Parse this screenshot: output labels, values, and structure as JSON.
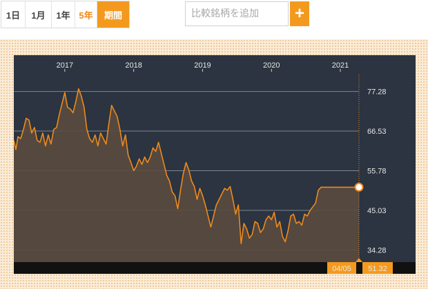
{
  "toolbar": {
    "ranges": [
      "1日",
      "1月",
      "1年",
      "5年",
      "期間"
    ],
    "active_range": "5年",
    "search_placeholder": "比較銘柄を追加",
    "add_button_label": "+"
  },
  "colors": {
    "accent": "#f39a1e",
    "panel": "#2b3440",
    "line": "#ef8a1c",
    "fill": "#5a4a3f",
    "grid": "#9aa3ad"
  },
  "chart_data": {
    "type": "area",
    "x_tick_labels": [
      "2017",
      "2018",
      "2019",
      "2020",
      "2021"
    ],
    "y_tick_labels": [
      "77.28",
      "66.53",
      "55.78",
      "45.03",
      "34.28"
    ],
    "ylim": [
      31.0,
      83.0
    ],
    "xlim": [
      2016.26,
      2021.27
    ],
    "grid": true,
    "current_date_label": "04/05",
    "current_value_label": "51.32",
    "series": [
      {
        "x": [
          2016.26,
          2016.29,
          2016.32,
          2016.36,
          2016.4,
          2016.44,
          2016.48,
          2016.52,
          2016.56,
          2016.6,
          2016.64,
          2016.68,
          2016.72,
          2016.76,
          2016.8,
          2016.84,
          2016.88,
          2016.92,
          2016.96,
          2017.0,
          2017.04,
          2017.08,
          2017.12,
          2017.16,
          2017.2,
          2017.24,
          2017.28,
          2017.32,
          2017.36,
          2017.4,
          2017.44,
          2017.48,
          2017.52,
          2017.56,
          2017.6,
          2017.64,
          2017.68,
          2017.72,
          2017.76,
          2017.8,
          2017.84,
          2017.88,
          2017.92,
          2017.96,
          2018.0,
          2018.04,
          2018.08,
          2018.12,
          2018.16,
          2018.2,
          2018.24,
          2018.28,
          2018.32,
          2018.36,
          2018.4,
          2018.44,
          2018.48,
          2018.52,
          2018.56,
          2018.6,
          2018.64,
          2018.68,
          2018.72,
          2018.76,
          2018.8,
          2018.84,
          2018.88,
          2018.92,
          2018.96,
          2019.0,
          2019.04,
          2019.08,
          2019.12,
          2019.16,
          2019.2,
          2019.24,
          2019.28,
          2019.32,
          2019.36,
          2019.4,
          2019.44,
          2019.48,
          2019.52,
          2019.56,
          2019.6,
          2019.64,
          2019.68,
          2019.72,
          2019.76,
          2019.8,
          2019.84,
          2019.88,
          2019.92,
          2019.96,
          2020.0,
          2020.04,
          2020.08,
          2020.12,
          2020.16,
          2020.2,
          2020.24,
          2020.28,
          2020.32,
          2020.36,
          2020.4,
          2020.44,
          2020.48,
          2020.52,
          2020.56,
          2020.6,
          2020.64,
          2020.68,
          2020.72,
          2020.76,
          2020.8,
          2020.84,
          2020.88,
          2020.92,
          2020.96,
          2021.0,
          2021.04,
          2021.08,
          2021.12,
          2021.16,
          2021.2,
          2021.24,
          2021.27
        ],
        "y": [
          64.0,
          61.5,
          65.0,
          64.5,
          67.0,
          70.0,
          69.5,
          66.0,
          67.5,
          64.0,
          63.5,
          66.0,
          62.5,
          65.5,
          63.0,
          67.0,
          67.5,
          71.0,
          74.0,
          77.0,
          73.0,
          72.5,
          71.5,
          74.5,
          78.0,
          76.0,
          73.0,
          67.0,
          64.5,
          63.5,
          65.5,
          62.5,
          66.0,
          64.5,
          63.0,
          68.5,
          73.5,
          72.0,
          70.5,
          67.0,
          62.5,
          65.5,
          60.0,
          58.0,
          55.8,
          57.0,
          59.0,
          57.5,
          59.5,
          58.0,
          59.5,
          62.0,
          61.0,
          63.5,
          60.5,
          57.5,
          54.5,
          53.0,
          50.0,
          49.0,
          45.5,
          50.5,
          55.0,
          58.0,
          56.0,
          53.0,
          51.5,
          48.0,
          51.0,
          49.0,
          46.5,
          43.5,
          40.5,
          43.5,
          46.5,
          48.0,
          49.5,
          51.0,
          50.5,
          51.5,
          48.0,
          44.0,
          46.5,
          36.0,
          41.5,
          40.0,
          37.5,
          38.5,
          42.0,
          41.5,
          39.0,
          40.0,
          42.5,
          43.5,
          42.5,
          44.5,
          40.5,
          42.0,
          38.0,
          36.5,
          39.5,
          43.5,
          44.0,
          41.5,
          42.0,
          41.0,
          44.0,
          43.5,
          45.0,
          46.0,
          47.0,
          50.5,
          51.32,
          51.32,
          51.32,
          51.32,
          51.32,
          51.32,
          51.32,
          51.32,
          51.32,
          51.32,
          51.32,
          51.32,
          51.32,
          51.32,
          51.32
        ]
      }
    ]
  }
}
